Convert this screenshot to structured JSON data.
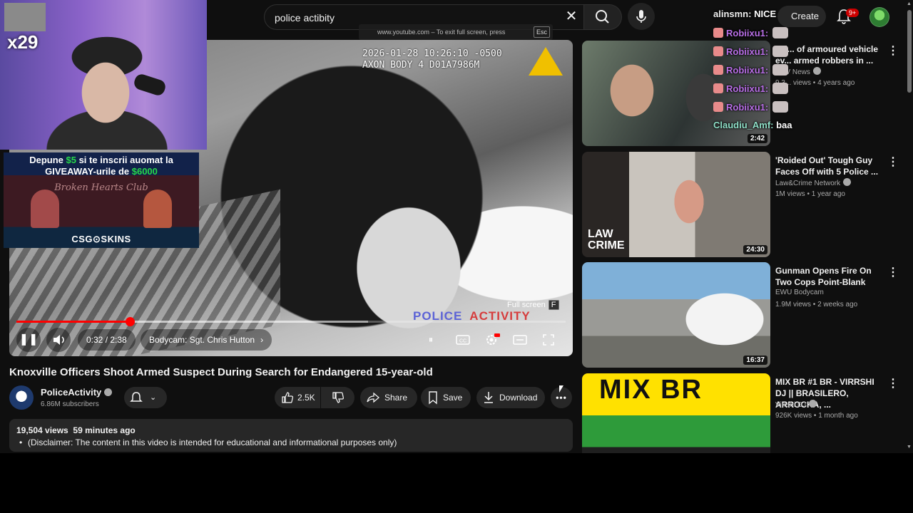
{
  "search": {
    "query": "police actibity"
  },
  "header": {
    "create_label": "Create",
    "notifications_badge": "9+"
  },
  "fullscreen_hint": {
    "text": "www.youtube.com – To exit full screen, press",
    "key": "Esc"
  },
  "overlay": {
    "timestamp": "2026-01-28 10:26:10 -0500\nAXON BODY 4 D01A7986M",
    "watermark_left": "POLICE",
    "watermark_right": "ACTIVITY",
    "fullscreen_tip": "Full screen",
    "fullscreen_key": "F"
  },
  "player": {
    "time": "0:32 / 2:38",
    "chapter": "Bodycam: Sgt. Chris Hutton",
    "progress_fraction": 0.206,
    "buffered_fraction": 0.64
  },
  "stream": {
    "multiplier": "x29",
    "ad_line1_pre": "Depune ",
    "ad_line1_amount": "$5",
    "ad_line1_post": " si te inscrii auomat la",
    "ad_line2_pre": "GIVEAWAY-urile de ",
    "ad_line2_amount": "$6000",
    "ad_club": "Broken Hearts Club",
    "ad_brand": "CSG⊙SKINS"
  },
  "chat": [
    {
      "user": "alinsmn:",
      "msg": "NICE",
      "user_color": "#f1f1f1",
      "badge": false,
      "emote": false
    },
    {
      "user": "Robiixu1:",
      "msg": "",
      "user_color": "#b86ee6",
      "badge": true,
      "emote": true
    },
    {
      "user": "Robiixu1:",
      "msg": "",
      "user_color": "#b86ee6",
      "badge": true,
      "emote": true
    },
    {
      "user": "Robiixu1:",
      "msg": "",
      "user_color": "#b86ee6",
      "badge": true,
      "emote": true
    },
    {
      "user": "Robiixu1:",
      "msg": "",
      "user_color": "#b86ee6",
      "badge": true,
      "emote": true
    },
    {
      "user": "Robiixu1:",
      "msg": "",
      "user_color": "#b86ee6",
      "badge": true,
      "emote": true
    },
    {
      "user": "Claudiu_Amf:",
      "msg": "baa",
      "user_color": "#8fe0c8",
      "badge": false,
      "emote": false
    }
  ],
  "video": {
    "title": "Knoxville Officers Shoot Armed Suspect During Search for Endangered 15-year-old",
    "channel": "PoliceActivity",
    "subscribers": "6.86M subscribers",
    "likes": "2.5K",
    "share_label": "Share",
    "save_label": "Save",
    "download_label": "Download",
    "views": "19,504 views",
    "posted": "59 minutes ago",
    "disclaimer": "(Disclaimer: The content in this video is intended for educational and informational purposes only)"
  },
  "recommendations": [
    {
      "title": "Dri... of armoured vehicle ev... armed robbers in ...",
      "channel": "...TV News",
      "meta": "9.3... views • 4 years ago",
      "duration": "2:42",
      "verified": true
    },
    {
      "title": "'Roided Out' Tough Guy Faces Off with 5 Police ...",
      "channel": "Law&Crime Network",
      "meta": "1M views • 1 year ago",
      "duration": "24:30",
      "verified": true,
      "thumb_text": "LAW CRIME"
    },
    {
      "title": "Gunman Opens Fire On Two Cops Point-Blank",
      "channel": "EWU Bodycam",
      "meta": "1.9M views • 2 weeks ago",
      "duration": "16:37",
      "verified": false
    },
    {
      "title": "MIX BR #1 BR - VIRRSHI DJ || BRASILERO, ARROCHA, ...",
      "channel": "Virrshi DJ",
      "meta": "926K views • 1 month ago",
      "duration": "",
      "verified": true,
      "thumb_text": "MIX BR"
    }
  ]
}
